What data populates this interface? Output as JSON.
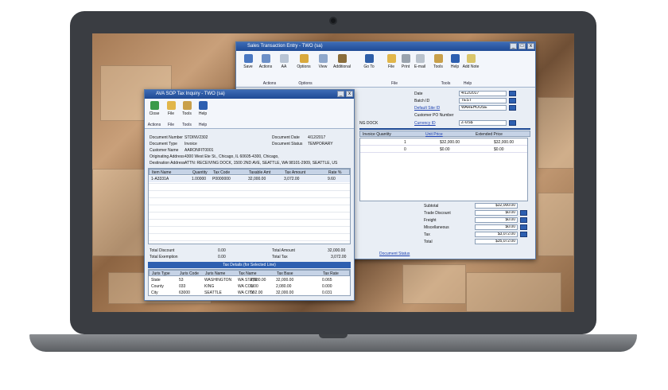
{
  "ste": {
    "title": "Sales Transaction Entry  -  TWO (sa)",
    "buttons": [
      {
        "label": "Save",
        "icon": "save-icon",
        "color": "#4a78c2"
      },
      {
        "label": "Actions",
        "icon": "actions-icon",
        "color": "#6c90c8"
      },
      {
        "label": "AA",
        "icon": "aa-icon",
        "color": "#b8c4d4"
      },
      {
        "label": "Options",
        "icon": "options-icon",
        "color": "#d9a93d"
      },
      {
        "label": "View",
        "icon": "view-icon",
        "color": "#8fa8cc"
      },
      {
        "label": "Additional",
        "icon": "additional-icon",
        "color": "#8a6d3b"
      },
      {
        "label": "Go To",
        "icon": "goto-icon",
        "color": "#2f5fa8"
      },
      {
        "label": "File",
        "icon": "folder-icon",
        "color": "#e1b64a"
      },
      {
        "label": "Print",
        "icon": "printer-icon",
        "color": "#9aa3ad"
      },
      {
        "label": "E-mail",
        "icon": "email-icon",
        "color": "#b9c2cc"
      },
      {
        "label": "Tools",
        "icon": "tools-icon",
        "color": "#c9a04a"
      },
      {
        "label": "Help",
        "icon": "help-icon",
        "color": "#2d5fb0"
      },
      {
        "label": "Add Note",
        "icon": "note-icon",
        "color": "#d9c56a"
      }
    ],
    "groups": [
      "Actions",
      "Options",
      "File",
      "Tools",
      "Help"
    ],
    "labels": {
      "date": "Date",
      "batch": "Batch ID",
      "site": "Default Site ID",
      "cpo": "Customer PO Number",
      "currency": "Currency ID",
      "ship": "NG DOCK",
      "qty": "Invoice Quantity",
      "unit": "Unit Price",
      "ext": "Extended Price"
    },
    "values": {
      "date": "4/12/2017",
      "batch": "TEST",
      "site": "WAREHOUSE",
      "currency": "Z-US$"
    },
    "rows": [
      {
        "qty": "1",
        "unit": "$32,000.00",
        "ext": "$32,000.00"
      },
      {
        "qty": "0",
        "unit": "$0.00",
        "ext": "$0.00"
      }
    ],
    "totals": [
      {
        "label": "Subtotal",
        "value": "$32,000.00"
      },
      {
        "label": "Trade Discount",
        "value": "$0.00"
      },
      {
        "label": "Freight",
        "value": "$0.00"
      },
      {
        "label": "Miscellaneous",
        "value": "$0.00"
      },
      {
        "label": "Tax",
        "value": "$3,072.00"
      },
      {
        "label": "Total",
        "value": "$35,072.00"
      }
    ],
    "docstatus": "Document Status"
  },
  "tax": {
    "title": "AVA SOP Tax Inquiry  -  TWO (sa)",
    "buttons": [
      {
        "label": "Close",
        "icon": "close-icon",
        "color": "#3a9a4a"
      },
      {
        "label": "File",
        "icon": "folder-icon",
        "color": "#e1b64a"
      },
      {
        "label": "Tools",
        "icon": "tools-icon",
        "color": "#c9a04a"
      },
      {
        "label": "Help",
        "icon": "help-icon",
        "color": "#2d5fb0"
      }
    ],
    "groups": [
      "Actions",
      "File",
      "Tools",
      "Help"
    ],
    "hdr": {
      "docnum_l": "Document Number",
      "docnum": "STDINV2302",
      "doctype_l": "Document Type",
      "doctype": "Invoice",
      "custname_l": "Customer Name",
      "custname": "AARONFIT0001",
      "origin_l": "Originating Address",
      "origin": "4300 West Ete St., Chicago, IL 60605-4300, Chicago,",
      "dest_l": "Destination Address",
      "dest": "ATTN: RECEIVING DOCK, 1500 2ND AVE, SEATTLE, WA 98101-2909, SEATTLE, US",
      "docdate_l": "Document Date",
      "docdate": "4/12/2017",
      "docstatus_l": "Document Status",
      "docstatus": "TEMPORARY"
    },
    "cols": [
      "Item Name",
      "Quantity",
      "Tax Code",
      "Taxable Amt",
      "Tax Amount",
      "Rate %"
    ],
    "row": [
      "1-A3331A",
      "1.00000",
      "P0000000",
      "32,000.00",
      "3,072.00",
      "9.60"
    ],
    "sum": {
      "disc_l": "Total Discount",
      "disc": "0.00",
      "exempt_l": "Total Exemption",
      "exempt": "0.00",
      "amt_l": "Total Amount",
      "amt": "32,000.00",
      "tax_l": "Total Tax",
      "tax": "3,072.00"
    },
    "details_title": "Tax Details (for Selected Line)",
    "dcols": [
      "Juris Type",
      "Juris Code",
      "Juris Name",
      "Tax Name",
      "Tax Base",
      "Tax Rate"
    ],
    "drows": [
      [
        "State",
        "53",
        "WASHINGTON",
        "WA STATE",
        "32,000.00",
        "0.065"
      ],
      [
        "County",
        "033",
        "KING",
        "WA COU",
        "2,080.00",
        "0.000"
      ],
      [
        "City",
        "63000",
        "SEATTLE",
        "WA CITY",
        "32,000.00",
        "0.031"
      ]
    ],
    "dextra": [
      "2,080.00",
      "0.00",
      "992.00"
    ]
  }
}
